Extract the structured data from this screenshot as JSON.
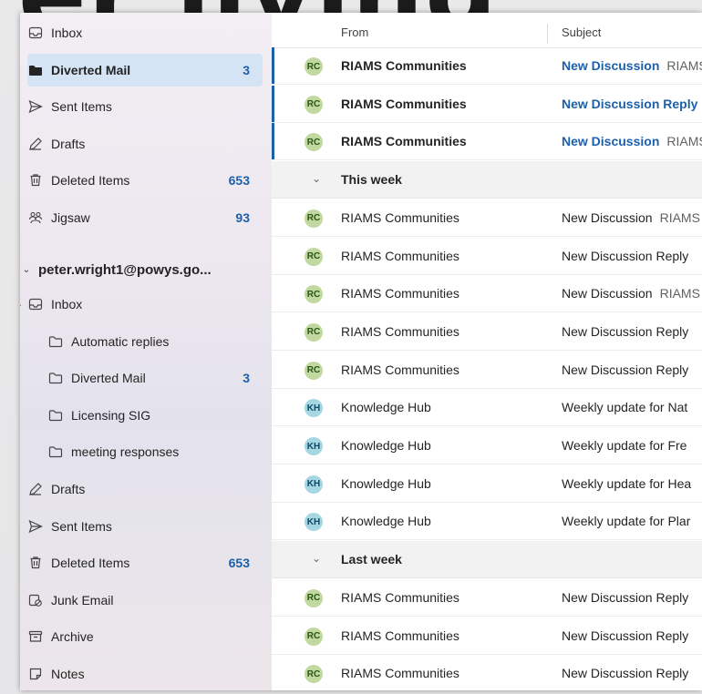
{
  "folders_top": [
    {
      "label": "Inbox",
      "icon": "inbox-icon",
      "count": ""
    },
    {
      "label": "Diverted Mail",
      "icon": "folder-filled-icon",
      "count": "3",
      "selected": true
    },
    {
      "label": "Sent Items",
      "icon": "send-icon",
      "count": ""
    },
    {
      "label": "Drafts",
      "icon": "pencil-icon",
      "count": ""
    },
    {
      "label": "Deleted Items",
      "icon": "trash-icon",
      "count": "653"
    },
    {
      "label": "Jigsaw",
      "icon": "group-icon",
      "count": "93"
    }
  ],
  "account": "peter.wright1@powys.go...",
  "folders_account": [
    {
      "label": "Inbox",
      "icon": "inbox-icon",
      "count": "",
      "expand": true
    },
    {
      "label": "Automatic replies",
      "icon": "folder-icon",
      "count": "",
      "child": true
    },
    {
      "label": "Diverted Mail",
      "icon": "folder-icon",
      "count": "3",
      "child": true
    },
    {
      "label": "Licensing SIG",
      "icon": "folder-icon",
      "count": "",
      "child": true
    },
    {
      "label": "meeting responses",
      "icon": "folder-icon",
      "count": "",
      "child": true
    },
    {
      "label": "Drafts",
      "icon": "pencil-icon",
      "count": ""
    },
    {
      "label": "Sent Items",
      "icon": "send-icon",
      "count": ""
    },
    {
      "label": "Deleted Items",
      "icon": "trash-icon",
      "count": "653"
    },
    {
      "label": "Junk Email",
      "icon": "junk-icon",
      "count": ""
    },
    {
      "label": "Archive",
      "icon": "archive-icon",
      "count": ""
    },
    {
      "label": "Notes",
      "icon": "note-icon",
      "count": ""
    }
  ],
  "columns": {
    "from": "From",
    "subject": "Subject"
  },
  "messages_top": [
    {
      "avatar": "RC",
      "from": "RIAMS Communities",
      "subject": "New Discussion",
      "preview": "RIAMS",
      "unread": true
    },
    {
      "avatar": "RC",
      "from": "RIAMS Communities",
      "subject": "New Discussion Reply",
      "preview": "",
      "unread": true
    },
    {
      "avatar": "RC",
      "from": "RIAMS Communities",
      "subject": "New Discussion",
      "preview": "RIAMS",
      "unread": true
    }
  ],
  "group_this_week": "This week",
  "messages_week": [
    {
      "avatar": "RC",
      "from": "RIAMS Communities",
      "subject": "New Discussion",
      "preview": "RIAMS"
    },
    {
      "avatar": "RC",
      "from": "RIAMS Communities",
      "subject": "New Discussion Reply",
      "preview": ""
    },
    {
      "avatar": "RC",
      "from": "RIAMS Communities",
      "subject": "New Discussion",
      "preview": "RIAMS"
    },
    {
      "avatar": "RC",
      "from": "RIAMS Communities",
      "subject": "New Discussion Reply",
      "preview": ""
    },
    {
      "avatar": "RC",
      "from": "RIAMS Communities",
      "subject": "New Discussion Reply",
      "preview": ""
    },
    {
      "avatar": "KH",
      "from": "Knowledge Hub",
      "subject": "Weekly update for Nat",
      "preview": ""
    },
    {
      "avatar": "KH",
      "from": "Knowledge Hub",
      "subject": "Weekly update for Fre",
      "preview": ""
    },
    {
      "avatar": "KH",
      "from": "Knowledge Hub",
      "subject": "Weekly update for Hea",
      "preview": ""
    },
    {
      "avatar": "KH",
      "from": "Knowledge Hub",
      "subject": "Weekly update for Plar",
      "preview": ""
    }
  ],
  "group_last_week": "Last week",
  "messages_last": [
    {
      "avatar": "RC",
      "from": "RIAMS Communities",
      "subject": "New Discussion Reply",
      "preview": ""
    },
    {
      "avatar": "RC",
      "from": "RIAMS Communities",
      "subject": "New Discussion Reply",
      "preview": ""
    },
    {
      "avatar": "RC",
      "from": "RIAMS Communities",
      "subject": "New Discussion Reply",
      "preview": ""
    }
  ],
  "bg_text_big": "er living",
  "bg_text_small": "c"
}
